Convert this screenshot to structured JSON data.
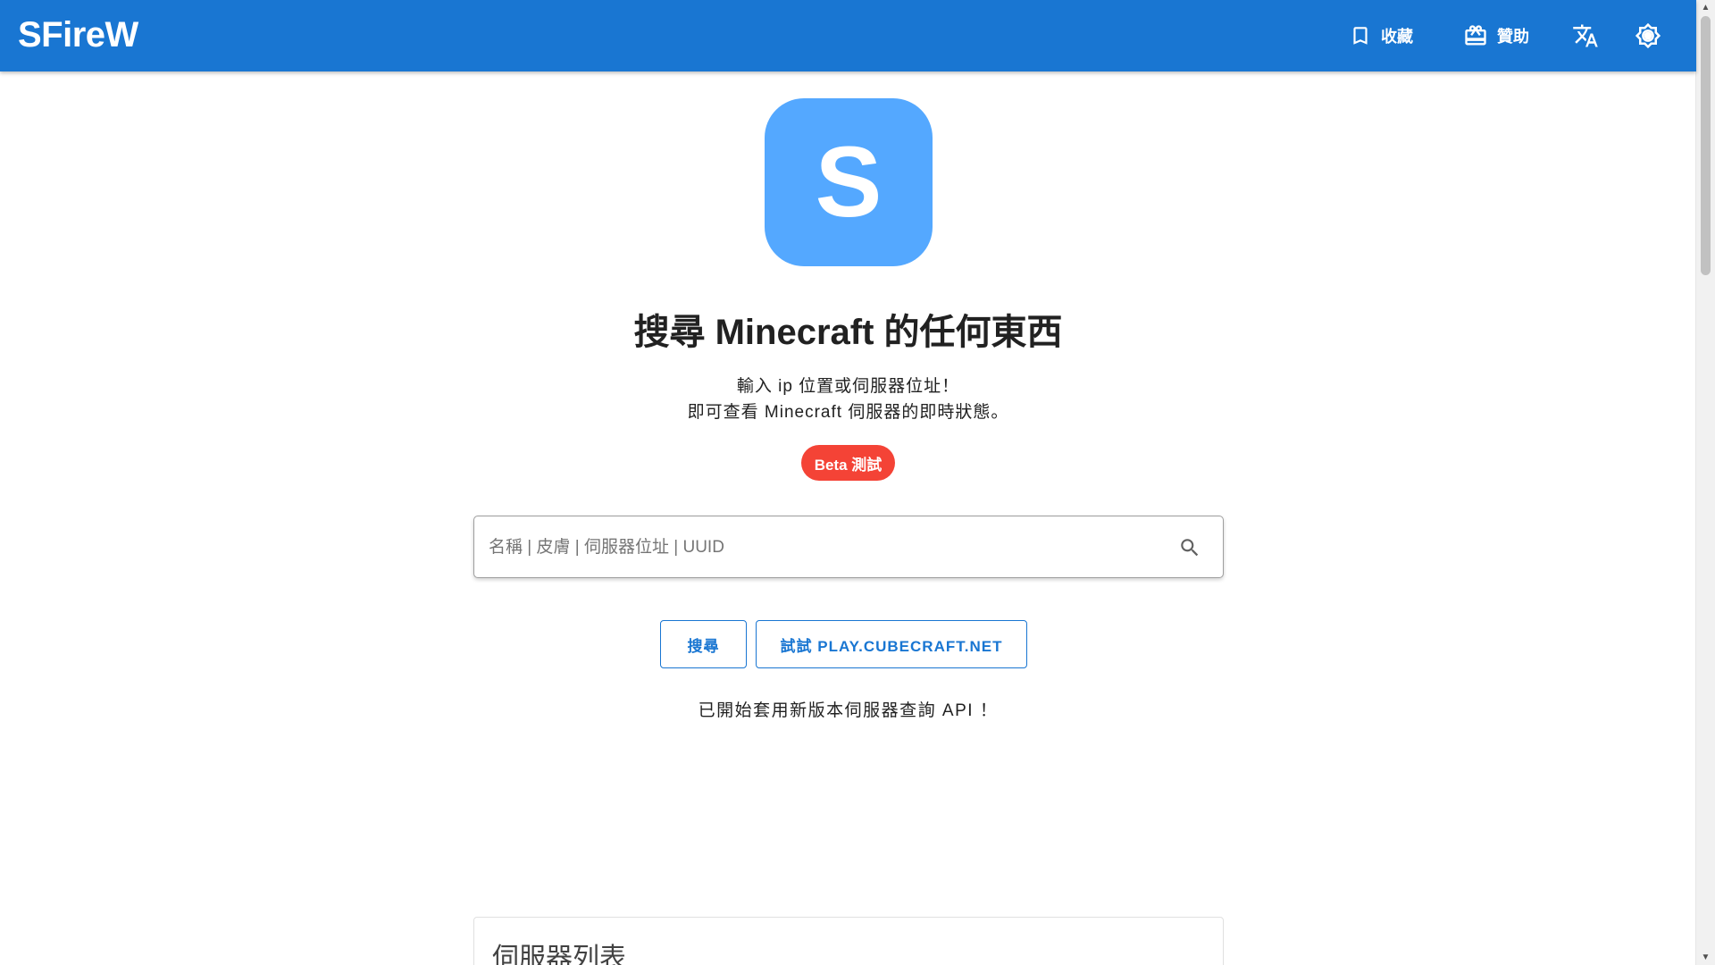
{
  "app": {
    "brand": "SFireW"
  },
  "nav": {
    "favorites_label": "收藏",
    "sponsor_label": "贊助",
    "translate_icon": "translate-icon",
    "theme_icon": "brightness-icon"
  },
  "hero": {
    "logo_letter": "S",
    "headline": "搜尋 Minecraft 的任何東西",
    "description_line1": "輸入 ip 位置或伺服器位址！",
    "description_line2": "即可查看 Minecraft 伺服器的即時狀態。",
    "badge": "Beta 測試"
  },
  "search": {
    "placeholder": "名稱 | 皮膚 | 伺服器位址 | UUID",
    "value": "",
    "search_button": "搜尋",
    "try_button": "試試 PLAY.CUBECRAFT.NET"
  },
  "notice": "已開始套用新版本伺服器查詢 API ！",
  "server_list": {
    "title": "伺服器列表"
  },
  "colors": {
    "appbar": "#1976d2",
    "logo_tile": "#54a8ff",
    "badge": "#f44336",
    "accent": "#1976d2"
  }
}
